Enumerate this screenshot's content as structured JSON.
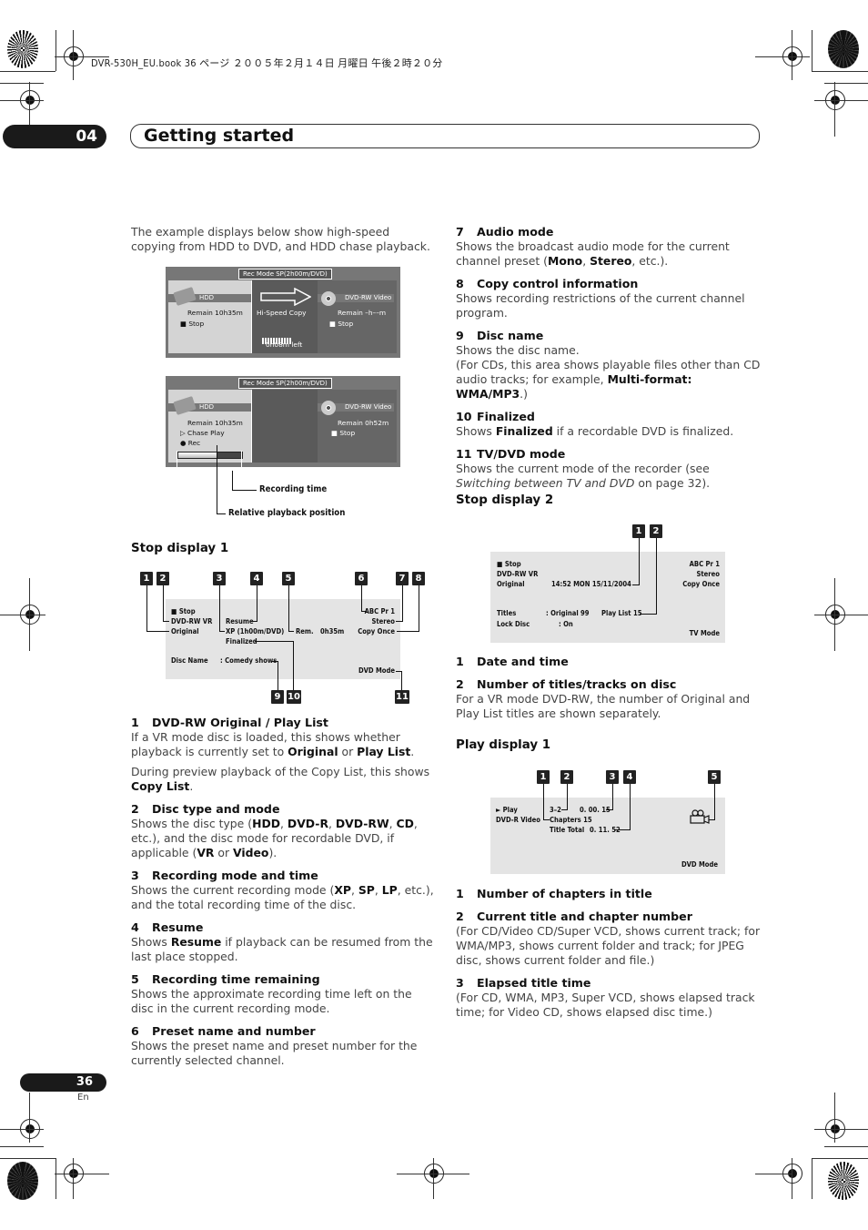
{
  "print_header": "DVR-530H_EU.book  36 ページ  ２００５年２月１４日  月曜日  午後２時２０分",
  "chapter": {
    "number": "04",
    "title": "Getting started"
  },
  "footer": {
    "page_number": "36",
    "language": "En"
  },
  "intro": "The example displays below show high-speed copying from HDD to DVD, and HDD chase playback.",
  "osd_copy": {
    "rec_mode": "Rec Mode    SP(2h00m/DVD)",
    "left_drive": "HDD",
    "left_remain": "Remain  10h35m",
    "left_status": "■ Stop",
    "mid_label": "Hi-Speed Copy",
    "mid_left": "0h08m left",
    "right_drive": "DVD-RW Video",
    "right_remain": "Remain  –h––m",
    "right_status": "■ Stop",
    "copy_progress_segments": 11
  },
  "osd_chase": {
    "rec_mode": "Rec Mode    SP(2h00m/DVD)",
    "left_drive": "HDD",
    "left_remain": "Remain  10h35m",
    "left_status1": "▷ Chase Play",
    "left_status2": "● Rec",
    "right_drive": "DVD-RW Video",
    "right_remain": "Remain  0h52m",
    "right_status": "■ Stop",
    "playback_position_fraction": 0.62,
    "callout_recording_time": "Recording time",
    "callout_playback_position": "Relative playback position"
  },
  "stop_display_1": {
    "title": "Stop display 1",
    "screen": {
      "status": "■ Stop",
      "disc": "DVD-RW   VR",
      "list": "Original",
      "resume": "Resume",
      "rec_mode": "XP (1h00m/DVD)",
      "finalized": "Finalized",
      "rem_label": "Rem.",
      "rem_value": "0h35m",
      "preset": "ABC  Pr 1",
      "audio": "Stereo",
      "copy": "Copy Once",
      "disc_name_label": "Disc Name",
      "disc_name_value": ":  Comedy shows",
      "mode": "DVD Mode"
    },
    "badges": [
      "1",
      "2",
      "3",
      "4",
      "5",
      "6",
      "7",
      "8",
      "9",
      "10",
      "11"
    ],
    "items": [
      {
        "num": "1",
        "heading": "DVD-RW Original / Play List",
        "html": "If a VR mode disc is loaded, this shows whether playback is currently set to <b>Original</b> or <b>Play List</b>.",
        "extra": "During preview playback of the Copy List, this shows <b>Copy List</b>."
      },
      {
        "num": "2",
        "heading": "Disc type and mode",
        "html": "Shows the disc type (<b>HDD</b>, <b>DVD-R</b>, <b>DVD-RW</b>, <b>CD</b>, etc.), and the disc mode for recordable DVD, if applicable (<b>VR</b> or <b>Video</b>)."
      },
      {
        "num": "3",
        "heading": "Recording mode and time",
        "html": "Shows the current recording mode (<b>XP</b>, <b>SP</b>, <b>LP</b>, etc.), and the total recording time of the disc."
      },
      {
        "num": "4",
        "heading": "Resume",
        "html": "Shows <b>Resume</b> if playback can be resumed from the last place stopped."
      },
      {
        "num": "5",
        "heading": "Recording time remaining",
        "html": "Shows the approximate recording time left on the disc in the current recording mode."
      },
      {
        "num": "6",
        "heading": "Preset name and number",
        "html": "Shows the preset name and preset number for the currently selected channel."
      },
      {
        "num": "7",
        "heading": "Audio mode",
        "html": "Shows the broadcast audio mode for the current channel preset (<b>Mono</b>, <b>Stereo</b>, etc.)."
      },
      {
        "num": "8",
        "heading": "Copy control information",
        "html": "Shows recording restrictions of the current channel program."
      },
      {
        "num": "9",
        "heading": "Disc name",
        "html": "Shows the disc name.<br>(For CDs, this area shows playable files other than CD audio tracks; for example, <b>Multi-format: WMA/MP3</b>.)"
      },
      {
        "num": "10",
        "heading": "Finalized",
        "html": "Shows <b>Finalized</b> if a recordable DVD is finalized."
      },
      {
        "num": "11",
        "heading": "TV/DVD mode",
        "html": "Shows the current mode of the recorder (see <i>Switching between TV and DVD</i> on page 32)."
      }
    ]
  },
  "stop_display_2": {
    "title": "Stop display 2",
    "screen": {
      "status": "■ Stop",
      "disc": "DVD-RW   VR",
      "list": "Original",
      "datetime": "14:52    MON    15/11/2004",
      "preset": "ABC  Pr 1",
      "audio": "Stereo",
      "copy": "Copy Once",
      "titles_label": "Titles",
      "titles_value": ":  Original   99",
      "playlist": "Play List   15",
      "lock_label": "Lock Disc",
      "lock_value": ":  On",
      "mode": "TV Mode"
    },
    "badges": [
      "1",
      "2"
    ],
    "items": [
      {
        "num": "1",
        "heading": "Date and time",
        "html": ""
      },
      {
        "num": "2",
        "heading": "Number of titles/tracks on disc",
        "html": "For a VR mode DVD-RW, the number of Original and Play List titles are shown separately."
      }
    ]
  },
  "play_display_1": {
    "title": "Play display 1",
    "screen": {
      "status": "► Play",
      "disc": "DVD-R   Video",
      "title_chapter": "3–2",
      "elapsed": "0. 00. 15",
      "chapters": "Chapters   15",
      "title_total_label": "Title Total",
      "title_total_value": "0. 11. 52",
      "mode": "DVD Mode"
    },
    "badges": [
      "1",
      "2",
      "3",
      "4",
      "5"
    ],
    "items": [
      {
        "num": "1",
        "heading": "Number of chapters in title",
        "html": ""
      },
      {
        "num": "2",
        "heading": "Current title and chapter number",
        "html": "(For CD/Video CD/Super VCD, shows current track; for WMA/MP3, shows current folder and track; for JPEG disc, shows current folder and file.)"
      },
      {
        "num": "3",
        "heading": "Elapsed title time",
        "html": "(For CD, WMA, MP3, Super VCD, shows elapsed track time; for Video CD, shows elapsed disc time.)"
      }
    ]
  }
}
